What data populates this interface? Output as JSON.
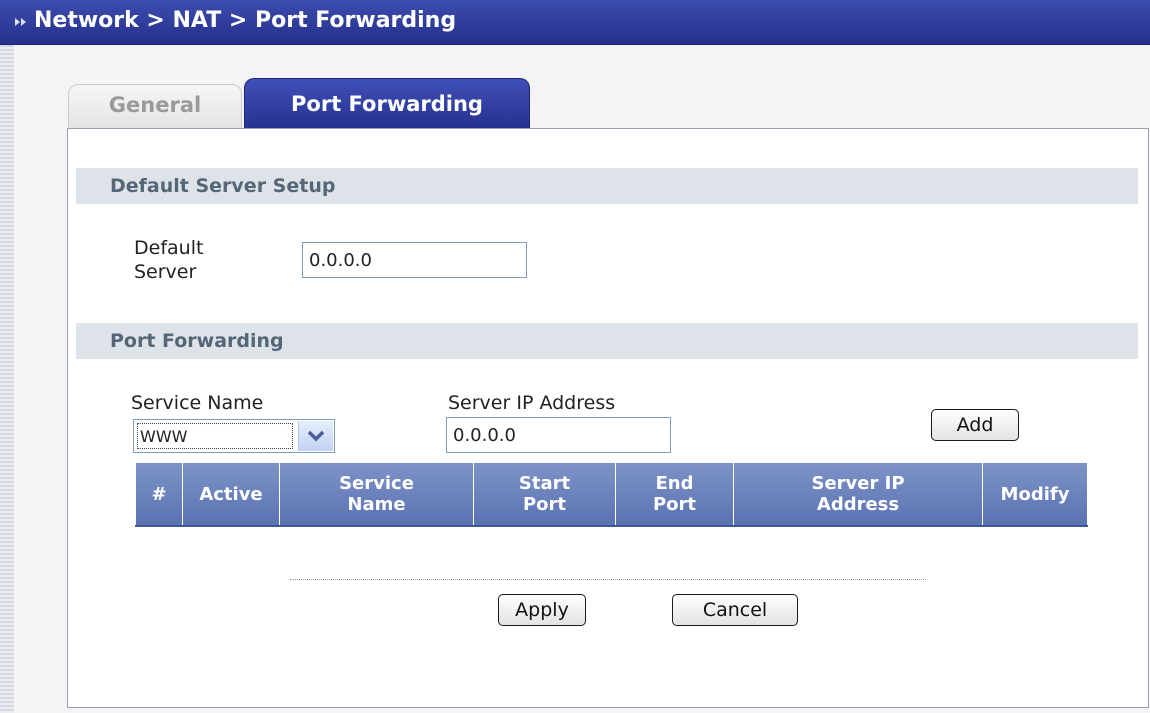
{
  "header": {
    "breadcrumb": "Network > NAT > Port Forwarding"
  },
  "tabs": [
    {
      "label": "General",
      "active": false
    },
    {
      "label": "Port Forwarding",
      "active": true
    }
  ],
  "default_server": {
    "section_title": "Default Server Setup",
    "label_line1": "Default",
    "label_line2": "Server",
    "value": "0.0.0.0"
  },
  "port_forwarding": {
    "section_title": "Port Forwarding",
    "service_name_label": "Service Name",
    "service_name_selected": "WWW",
    "server_ip_label": "Server IP Address",
    "server_ip_value": "0.0.0.0",
    "add_label": "Add",
    "table": {
      "columns": [
        {
          "line1": "#",
          "line2": ""
        },
        {
          "line1": "Active",
          "line2": ""
        },
        {
          "line1": "Service",
          "line2": "Name"
        },
        {
          "line1": "Start",
          "line2": "Port"
        },
        {
          "line1": "End",
          "line2": "Port"
        },
        {
          "line1": "Server IP",
          "line2": "Address"
        },
        {
          "line1": "Modify",
          "line2": ""
        }
      ],
      "rows": []
    }
  },
  "actions": {
    "apply_label": "Apply",
    "cancel_label": "Cancel"
  },
  "colors": {
    "title_bar": "#2f3c9e",
    "active_tab": "#3544a8",
    "section_header_bg": "#dde3e8",
    "table_header": "#6b82bd"
  },
  "icons": {
    "breadcrumb_arrow": "arrow-right-icon",
    "dropdown": "chevron-down-icon"
  }
}
